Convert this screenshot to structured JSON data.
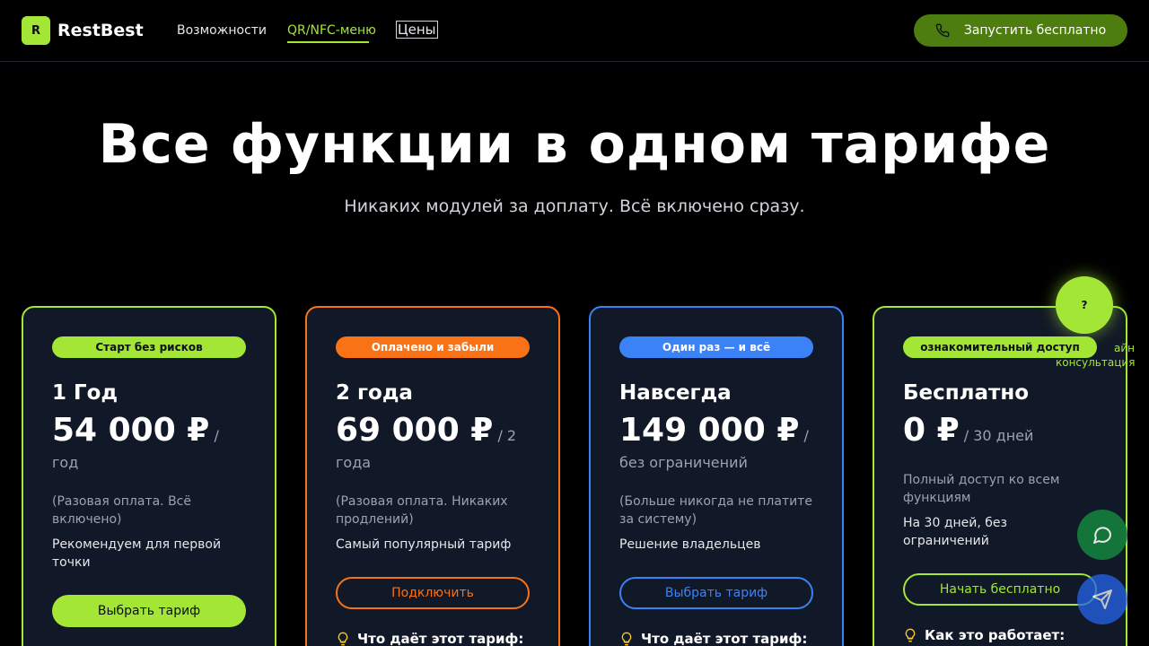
{
  "header": {
    "logo_letter": "R",
    "logo_text": "RestBest",
    "nav": [
      "Возможности",
      "QR/NFC-меню",
      "Цены"
    ],
    "cta_label": "Запустить бесплатно"
  },
  "hero": {
    "title": "Все функции в одном тарифе",
    "subtitle": "Никаких модулей за доплату. Всё включено сразу."
  },
  "plans": [
    {
      "badge": "Старт без рисков",
      "name": "1 Год",
      "price": "54 000 ₽",
      "period": " / год",
      "description": "(Разовая оплата. Всё включено)",
      "note": "Рекомендуем для первой точки",
      "button": "Выбрать тариф",
      "features_heading": ""
    },
    {
      "badge": "Оплачено и забыли",
      "name": "2 года",
      "price": "69 000 ₽",
      "period": " / 2 года",
      "description": "(Разовая оплата. Никаких продлений)",
      "note": "Самый популярный тариф",
      "button": "Подключить",
      "features_heading": "Что даёт этот тариф:"
    },
    {
      "badge": "Один раз — и всё",
      "name": "Навсегда",
      "price": "149 000 ₽",
      "period": " / без ограничений",
      "description": "(Больше никогда не платите за систему)",
      "note": "Решение владельцев",
      "button": "Выбрать тариф",
      "features_heading": "Что даёт этот тариф:"
    },
    {
      "badge": "ознакомительный доступ",
      "name": "Бесплатно",
      "price": "0 ₽",
      "period": " / 30 дней",
      "description": "Полный доступ ко всем функциям",
      "note": "На 30 дней, без ограничений",
      "button": "Начать бесплатно",
      "features_heading": "Как это работает:"
    }
  ],
  "widgets": {
    "help_symbol": "?",
    "help_label": "айн консультация"
  },
  "colors": {
    "accent_green": "#a3e635",
    "accent_orange": "#f97316",
    "accent_blue": "#3b82f6",
    "card_bg": "#111827",
    "page_bg": "#000000"
  }
}
